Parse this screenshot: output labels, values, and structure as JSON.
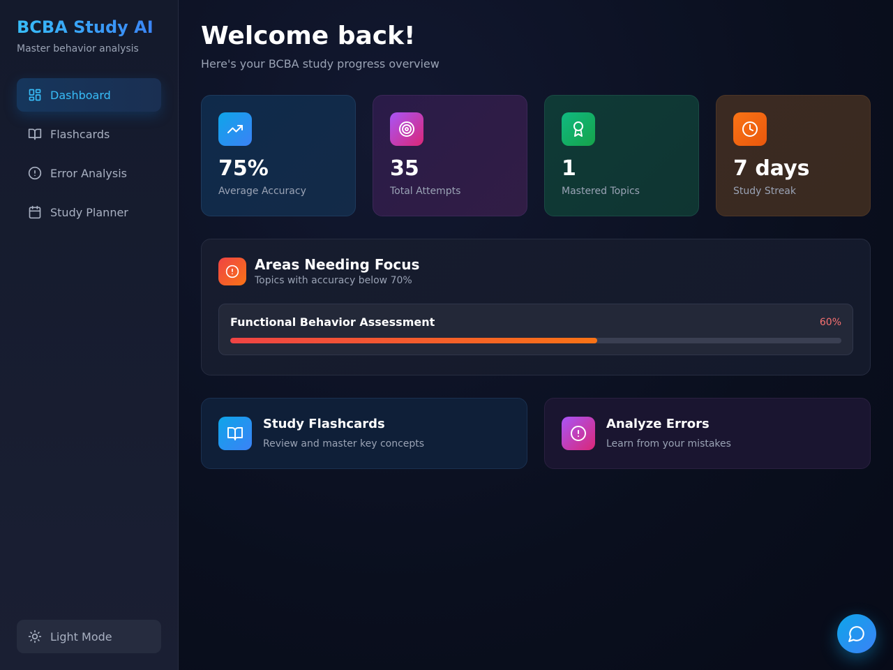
{
  "sidebar": {
    "brand_title": "BCBA Study AI",
    "brand_subtitle": "Master behavior analysis",
    "nav": [
      {
        "label": "Dashboard",
        "icon": "dashboard-icon",
        "active": true
      },
      {
        "label": "Flashcards",
        "icon": "book-open-icon",
        "active": false
      },
      {
        "label": "Error Analysis",
        "icon": "alert-circle-icon",
        "active": false
      },
      {
        "label": "Study Planner",
        "icon": "calendar-icon",
        "active": false
      }
    ],
    "light_mode_label": "Light Mode"
  },
  "header": {
    "title": "Welcome back!",
    "subtitle": "Here's your BCBA study progress overview"
  },
  "stats": [
    {
      "value": "75%",
      "label": "Average Accuracy",
      "icon": "trending-up-icon",
      "color": "#0ea5e9"
    },
    {
      "value": "35",
      "label": "Total Attempts",
      "icon": "target-icon",
      "color": "#a855f7"
    },
    {
      "value": "1",
      "label": "Mastered Topics",
      "icon": "award-icon",
      "color": "#10b981"
    },
    {
      "value": "7 days",
      "label": "Study Streak",
      "icon": "clock-icon",
      "color": "#f97316"
    }
  ],
  "focus": {
    "title": "Areas Needing Focus",
    "subtitle": "Topics with accuracy below 70%",
    "topics": [
      {
        "name": "Functional Behavior Assessment",
        "percent_label": "60%",
        "progress": 0.6
      }
    ]
  },
  "actions": [
    {
      "title": "Study Flashcards",
      "subtitle": "Review and master key concepts",
      "icon": "book-open-icon"
    },
    {
      "title": "Analyze Errors",
      "subtitle": "Learn from your mistakes",
      "icon": "alert-circle-icon"
    }
  ],
  "chat_button": {
    "icon": "chat-bubble-icon"
  },
  "colors": {
    "accent": "#38bdf8",
    "danger": "#ef4444",
    "background": "#0b1020"
  }
}
